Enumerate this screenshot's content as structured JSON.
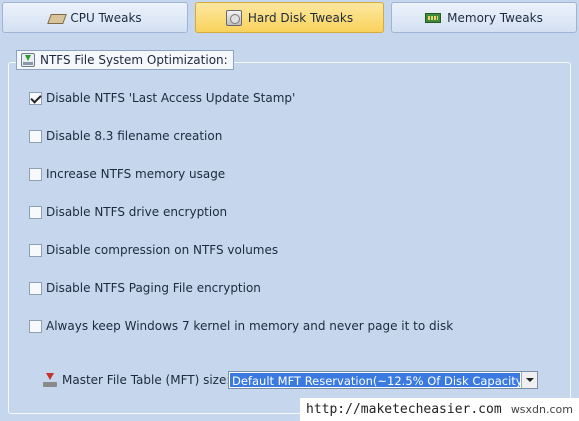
{
  "tabs": [
    {
      "label": "CPU Tweaks",
      "icon": "cpu-icon",
      "active": false
    },
    {
      "label": "Hard Disk Tweaks",
      "icon": "hard-disk-icon",
      "active": true
    },
    {
      "label": "Memory Tweaks",
      "icon": "memory-icon",
      "active": false
    }
  ],
  "group": {
    "title": "NTFS File System Optimization:",
    "icon": "ntfs-download-icon"
  },
  "options": [
    {
      "label": "Disable NTFS 'Last Access Update Stamp'",
      "checked": true
    },
    {
      "label": "Disable 8.3 filename creation",
      "checked": false
    },
    {
      "label": "Increase NTFS memory usage",
      "checked": false
    },
    {
      "label": "Disable NTFS drive encryption",
      "checked": false
    },
    {
      "label": "Disable compression on NTFS volumes",
      "checked": false
    },
    {
      "label": "Disable NTFS Paging File encryption",
      "checked": false
    },
    {
      "label": "Always keep Windows 7 kernel in memory and never page it to disk",
      "checked": false
    }
  ],
  "mft": {
    "label": "Master File Table (MFT) size:",
    "icon": "mft-download-icon",
    "selected": "Default MFT Reservation(~12.5% Of Disk Capacity)"
  },
  "watermark": {
    "url": "http://maketecheasier.com",
    "site": "wsxdn.com"
  },
  "colors": {
    "background": "#c6d6ec",
    "active_tab": "#f9d25c",
    "selection": "#3b7ae0"
  }
}
